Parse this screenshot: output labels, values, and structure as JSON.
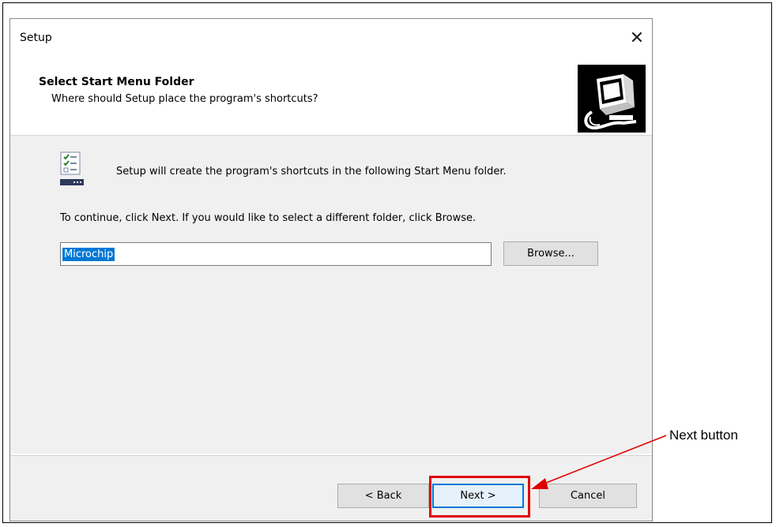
{
  "window": {
    "title": "Setup",
    "close_glyph": "✕"
  },
  "header": {
    "title": "Select Start Menu Folder",
    "subtitle": "Where should Setup place the program's shortcuts?"
  },
  "content": {
    "info_text": "Setup will create the program's shortcuts in the following Start Menu folder.",
    "continue_text": "To continue, click Next. If you would like to select a different folder, click Browse.",
    "folder_value": "Microchip",
    "browse_label": "Browse..."
  },
  "footer": {
    "back_label": "< Back",
    "next_label": "Next >",
    "cancel_label": "Cancel"
  },
  "annotation": {
    "callout_label": "Next button",
    "color": "#e00000"
  },
  "icons": {
    "wizard_image": "computer-setup-icon",
    "folder_icon": "start-menu-folder-icon"
  }
}
